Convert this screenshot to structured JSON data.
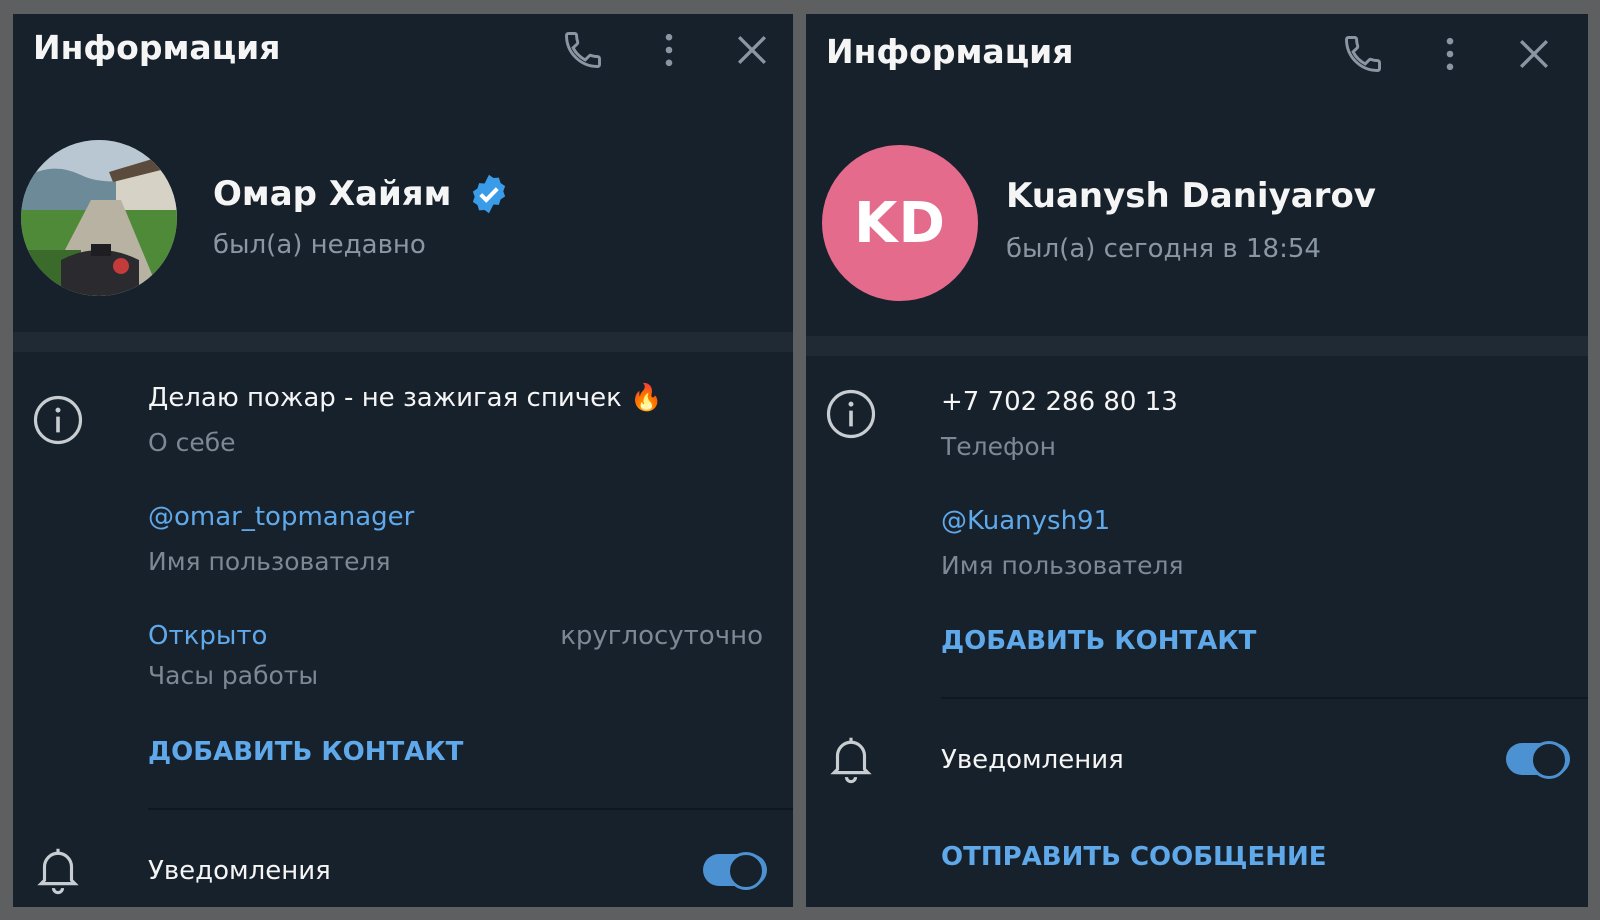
{
  "left_panel": {
    "header": {
      "title": "Информация"
    },
    "profile": {
      "name": "Омар Хайям",
      "status": "был(а) недавно"
    },
    "bio": {
      "value": "Делаю пожар - не зажигая спичек 🔥",
      "label": "О себе"
    },
    "username": {
      "value": "@omar_topmanager",
      "label": "Имя пользователя"
    },
    "hours": {
      "value": "Открыто",
      "extra": "круглосуточно",
      "label": "Часы работы"
    },
    "add_contact_label": "ДОБАВИТЬ КОНТАКТ",
    "notifications": {
      "label": "Уведомления",
      "enabled": true
    }
  },
  "right_panel": {
    "header": {
      "title": "Информация"
    },
    "profile": {
      "initials": "KD",
      "name": "Kuanysh Daniyarov",
      "status": "был(а) сегодня в 18:54"
    },
    "phone": {
      "value": "+7 702 286 80 13",
      "label": "Телефон"
    },
    "username": {
      "value": "@Kuanysh91",
      "label": "Имя пользователя"
    },
    "add_contact_label": "ДОБАВИТЬ КОНТАКТ",
    "notifications": {
      "label": "Уведомления",
      "enabled": true
    },
    "send_message_label": "ОТПРАВИТЬ СООБЩЕНИЕ"
  },
  "colors": {
    "panel_bg": "#17212b",
    "accent": "#5fa9ea",
    "avatar_kd": "#e46b8c",
    "verified": "#3a9be8"
  },
  "icons": [
    "phone-icon",
    "more-vertical-icon",
    "close-icon",
    "verified-icon",
    "info-icon",
    "bell-icon"
  ]
}
